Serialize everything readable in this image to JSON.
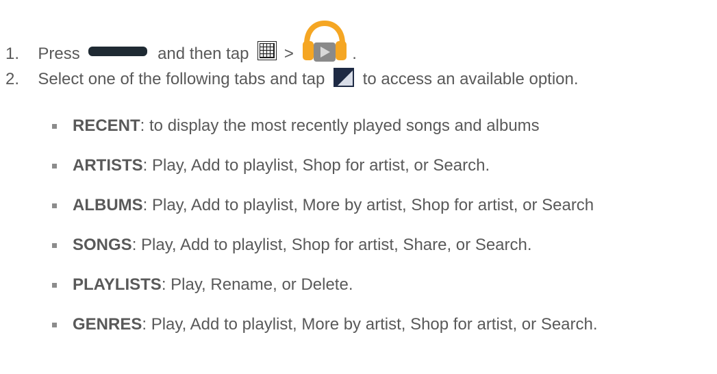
{
  "steps": [
    {
      "number": "1.",
      "parts": [
        "Press",
        "and then tap",
        ">",
        "."
      ]
    },
    {
      "number": "2.",
      "parts": [
        "Select one of the following tabs and tap",
        "to access an available option."
      ]
    }
  ],
  "tabs": [
    {
      "name": "RECENT",
      "desc": ": to display the most recently played songs and albums"
    },
    {
      "name": "ARTISTS",
      "desc": ": Play, Add to playlist, Shop for artist, or Search."
    },
    {
      "name": "ALBUMS",
      "desc": ": Play, Add to playlist, More by artist, Shop for artist, or Search"
    },
    {
      "name": "SONGS",
      "desc": ": Play, Add to playlist, Shop for artist, Share, or Search."
    },
    {
      "name": "PLAYLISTS",
      "desc": ": Play, Rename, or Delete."
    },
    {
      "name": "GENRES",
      "desc": ": Play, Add to playlist, More by artist, Shop for artist, or Search."
    }
  ],
  "icons": {
    "home_key": "home-key-icon",
    "apps": "apps-grid-icon",
    "music": "play-music-headphones-icon",
    "menu": "menu-icon"
  },
  "colors": {
    "text": "#595959",
    "home_key": "#1f2a33",
    "music_orange": "#f5a623",
    "menu_dark": "#1e2a44"
  }
}
